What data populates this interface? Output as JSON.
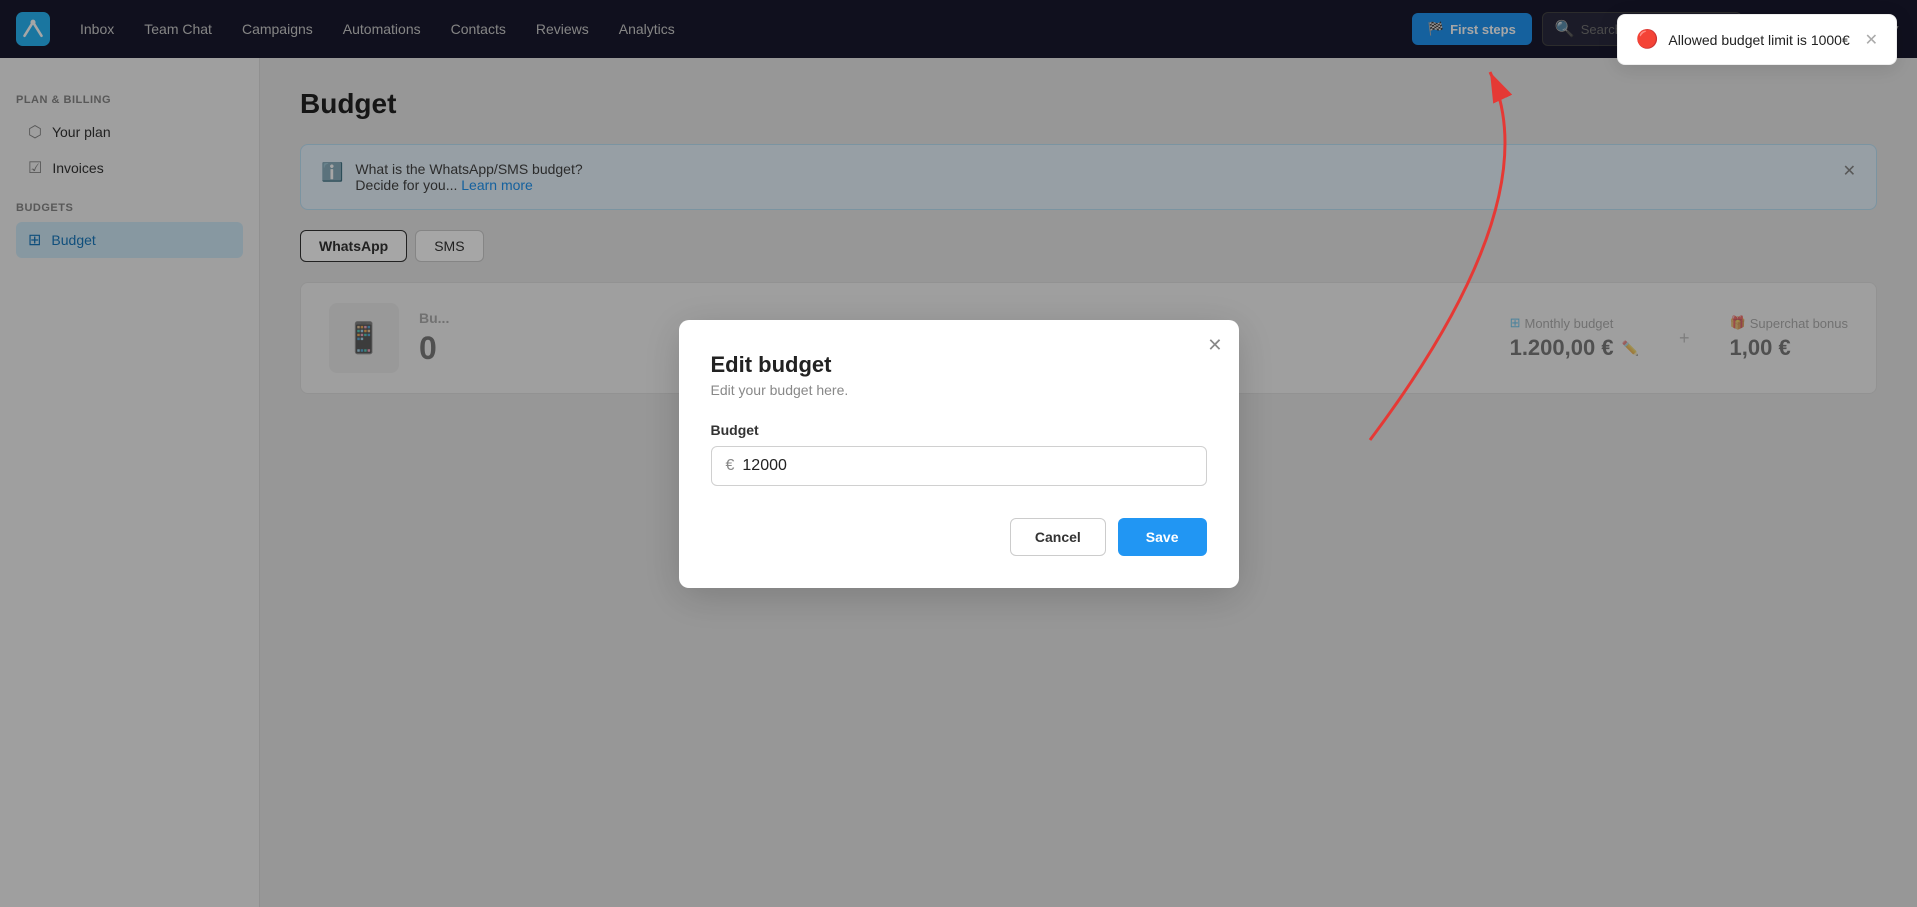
{
  "nav": {
    "links": [
      "Inbox",
      "Team Chat",
      "Campaigns",
      "Automations",
      "Contacts",
      "Reviews",
      "Analytics"
    ],
    "first_steps_label": "First steps",
    "search_placeholder": "Search",
    "search_value": "Search"
  },
  "sidebar": {
    "plan_billing_title": "Plan & Billing",
    "items": [
      {
        "id": "your-plan",
        "label": "Your plan",
        "icon": "☰"
      },
      {
        "id": "invoices",
        "label": "Invoices",
        "icon": "☑"
      }
    ],
    "budgets_title": "Budgets",
    "budget_item": {
      "id": "budget",
      "label": "Budget",
      "icon": "☰"
    }
  },
  "main": {
    "page_title": "Budget",
    "info_banner": {
      "text_main": "What is the WhatsApp/SMS budget?",
      "text_sub": "Decide for you...",
      "learn_more": "Learn more"
    },
    "tabs": [
      "WhatsApp",
      "SMS"
    ],
    "active_tab": "WhatsApp",
    "budget_card": {
      "label": "Bu...",
      "amount": "0",
      "monthly_budget_label": "Monthly budget",
      "monthly_budget_icon": "☰",
      "monthly_budget_value": "1.200,00 €",
      "superchat_bonus_label": "Superchat bonus",
      "superchat_bonus_icon": "🎁",
      "superchat_bonus_value": "1,00 €"
    }
  },
  "modal": {
    "title": "Edit budget",
    "subtitle": "Edit your budget here.",
    "budget_label": "Budget",
    "budget_value": "12000",
    "euro_sign": "€",
    "cancel_label": "Cancel",
    "save_label": "Save"
  },
  "toast": {
    "message": "Allowed budget limit is 1000€"
  }
}
